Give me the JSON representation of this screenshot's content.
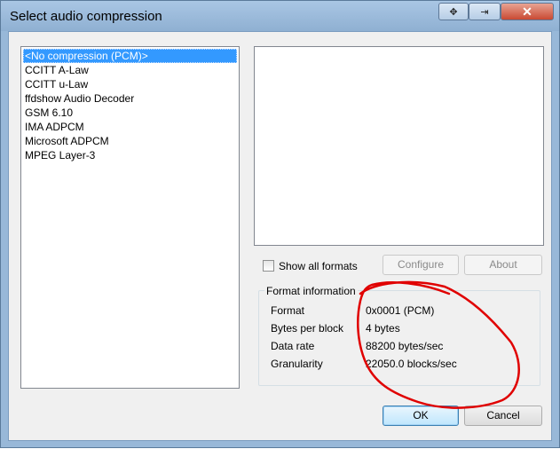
{
  "window": {
    "title": "Select audio compression"
  },
  "titlebar_buttons": [
    {
      "name": "move-icon",
      "glyph": "✥"
    },
    {
      "name": "restore-icon",
      "glyph": "⇥"
    },
    {
      "name": "close-icon",
      "glyph": "✕"
    }
  ],
  "codecs": [
    "<No compression (PCM)>",
    "CCITT A-Law",
    "CCITT u-Law",
    "ffdshow Audio Decoder",
    "GSM 6.10",
    "IMA ADPCM",
    "Microsoft ADPCM",
    "MPEG Layer-3"
  ],
  "selected_codec_index": 0,
  "show_all_formats": {
    "label": "Show all formats",
    "checked": false
  },
  "buttons": {
    "configure": "Configure",
    "about": "About",
    "ok": "OK",
    "cancel": "Cancel"
  },
  "format_info": {
    "title": "Format information",
    "rows": [
      {
        "label": "Format",
        "value": "0x0001 (PCM)"
      },
      {
        "label": "Bytes per block",
        "value": "4 bytes"
      },
      {
        "label": "Data rate",
        "value": "88200 bytes/sec"
      },
      {
        "label": "Granularity",
        "value": "22050.0 blocks/sec"
      }
    ]
  },
  "colors": {
    "selection": "#3399ff",
    "annotation": "#e00000"
  }
}
